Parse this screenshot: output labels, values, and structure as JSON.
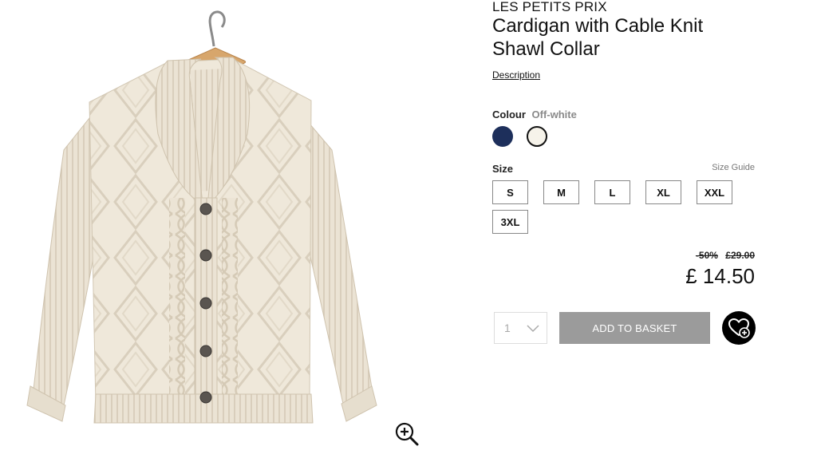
{
  "product": {
    "brand": "LES PETITS PRIX",
    "title": "Cardigan with Cable Knit Shawl Collar",
    "description_link": "Description",
    "image_alt": "cardigan-product-image"
  },
  "colour": {
    "label": "Colour",
    "selected": "Off-white",
    "swatches": [
      {
        "name": "navy",
        "hex": "#1d2f5b"
      },
      {
        "name": "off-white",
        "hex": "#f6f3ea"
      }
    ]
  },
  "size": {
    "label": "Size",
    "guide": "Size Guide",
    "options": [
      "S",
      "M",
      "L",
      "XL",
      "XXL",
      "3XL"
    ]
  },
  "pricing": {
    "discount": "-50%",
    "old_price": "£29.00",
    "price": "£ 14.50"
  },
  "purchase": {
    "quantity": "1",
    "add_to_basket": "ADD TO BASKET",
    "wishlist_icon": "heart-plus-icon"
  },
  "icons": {
    "zoom": "zoom-in-icon",
    "chevron": "chevron-down-icon"
  },
  "colors": {
    "button_grey": "#9b9b9b",
    "navy": "#1d2f5b",
    "text": "#111111"
  }
}
